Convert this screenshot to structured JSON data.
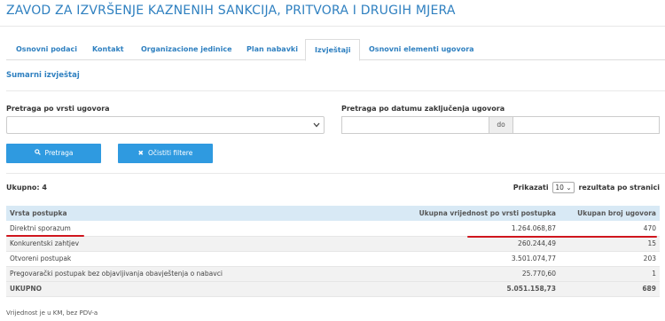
{
  "org_title": "ZAVOD ZA IZVRŠENJE KAZNENIH SANKCIJA, PRITVORA I DRUGIH MJERA",
  "tabs": [
    {
      "label": "Osnovni podaci",
      "active": false
    },
    {
      "label": "Kontakt",
      "active": false
    },
    {
      "label": "Organizacione jedinice",
      "active": false
    },
    {
      "label": "Plan nabavki",
      "active": false
    },
    {
      "label": "Izvještaji",
      "active": true
    },
    {
      "label": "Osnovni elementi ugovora",
      "active": false
    }
  ],
  "section_title": "Sumarni izvještaj",
  "filters": {
    "contract_type_label": "Pretraga po vrsti ugovora",
    "contract_type_value": "",
    "date_label": "Pretraga po datumu zaključenja ugovora",
    "date_from_value": "",
    "date_separator": "do",
    "date_to_value": ""
  },
  "buttons": {
    "search_label": "Pretraga",
    "clear_label": "Očistiti filtere"
  },
  "results": {
    "count_label": "Ukupno: 4",
    "show_label": "Prikazati",
    "per_page_value": "10",
    "per_page_suffix": "rezultata po stranici"
  },
  "table": {
    "headers": [
      "Vrsta postupka",
      "Ukupna vrijednost po vrsti postupka",
      "Ukupan broj ugovora"
    ],
    "rows": [
      [
        "Direktni sporazum",
        "1.264.068,87",
        "470"
      ],
      [
        "Konkurentski zahtjev",
        "260.244,49",
        "15"
      ],
      [
        "Otvoreni postupak",
        "3.501.074,77",
        "203"
      ],
      [
        "Pregovarački postupak bez objavljivanja obavještenja o nabavci",
        "25.770,60",
        "1"
      ]
    ],
    "total": [
      "UKUPNO",
      "5.051.158,73",
      "689"
    ]
  },
  "footnote": "Vrijednost je u KM, bez PDV-a",
  "colors": {
    "accent": "#2f80c0",
    "button": "#2f9ae0",
    "header_bg": "#d8e9f5",
    "highlight_underline": "#d0161e"
  },
  "icons": {
    "search": "search-icon",
    "clear": "close-icon",
    "select": "chevron-down-icon"
  }
}
